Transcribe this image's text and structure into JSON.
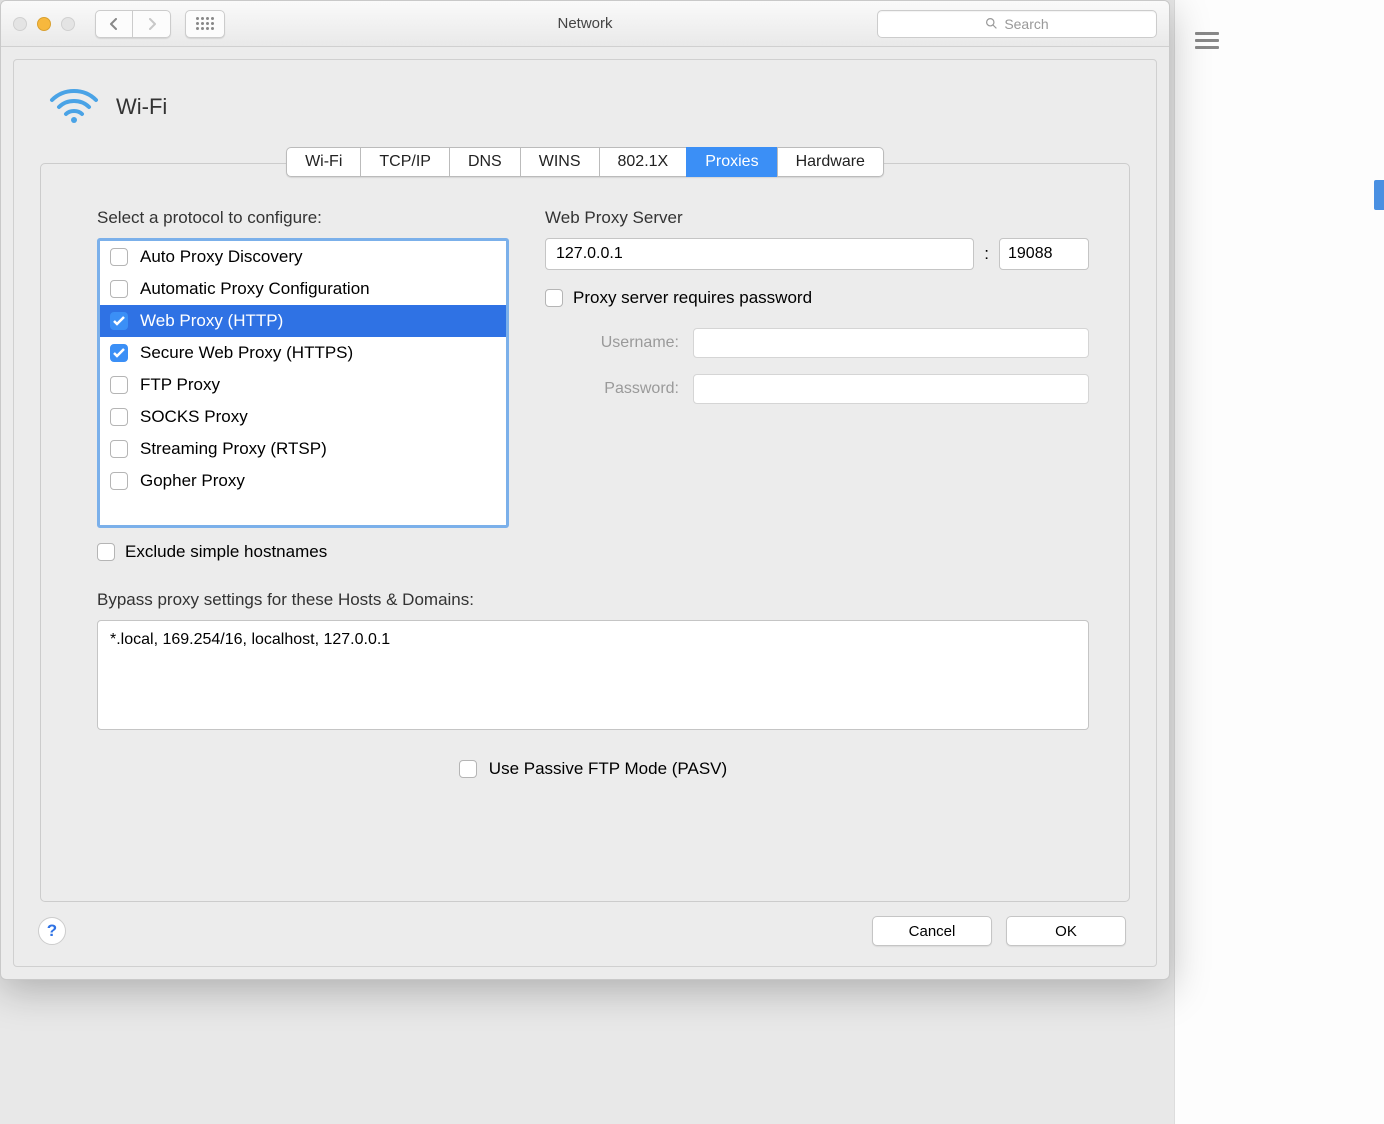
{
  "window": {
    "title": "Network",
    "searchPlaceholder": "Search"
  },
  "wifi": {
    "title": "Wi-Fi"
  },
  "tabs": [
    {
      "label": "Wi-Fi"
    },
    {
      "label": "TCP/IP"
    },
    {
      "label": "DNS"
    },
    {
      "label": "WINS"
    },
    {
      "label": "802.1X"
    },
    {
      "label": "Proxies"
    },
    {
      "label": "Hardware"
    }
  ],
  "protocolSection": {
    "label": "Select a protocol to configure:",
    "items": [
      {
        "label": "Auto Proxy Discovery",
        "checked": false,
        "selected": false
      },
      {
        "label": "Automatic Proxy Configuration",
        "checked": false,
        "selected": false
      },
      {
        "label": "Web Proxy (HTTP)",
        "checked": true,
        "selected": true
      },
      {
        "label": "Secure Web Proxy (HTTPS)",
        "checked": true,
        "selected": false
      },
      {
        "label": "FTP Proxy",
        "checked": false,
        "selected": false
      },
      {
        "label": "SOCKS Proxy",
        "checked": false,
        "selected": false
      },
      {
        "label": "Streaming Proxy (RTSP)",
        "checked": false,
        "selected": false
      },
      {
        "label": "Gopher Proxy",
        "checked": false,
        "selected": false
      }
    ],
    "excludeSimpleLabel": "Exclude simple hostnames"
  },
  "server": {
    "label": "Web Proxy Server",
    "host": "127.0.0.1",
    "port": "19088",
    "requiresPasswordLabel": "Proxy server requires password",
    "usernameLabel": "Username:",
    "passwordLabel": "Password:",
    "username": "",
    "password": ""
  },
  "bypass": {
    "label": "Bypass proxy settings for these Hosts & Domains:",
    "value": "*.local, 169.254/16, localhost, 127.0.0.1"
  },
  "pasv": {
    "label": "Use Passive FTP Mode (PASV)"
  },
  "footer": {
    "help": "?",
    "cancel": "Cancel",
    "ok": "OK"
  }
}
